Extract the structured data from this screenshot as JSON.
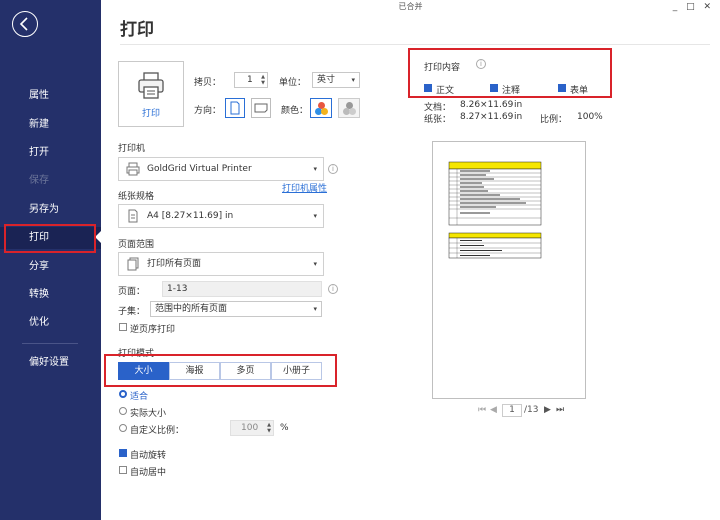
{
  "window": {
    "title": "已合并",
    "controls": "_ □ ✕"
  },
  "page_title": "打印",
  "sidebar": {
    "items": [
      {
        "label": "属性"
      },
      {
        "label": "新建"
      },
      {
        "label": "打开"
      },
      {
        "label": "保存"
      },
      {
        "label": "另存为"
      },
      {
        "label": "打印"
      },
      {
        "label": "分享"
      },
      {
        "label": "转换"
      },
      {
        "label": "优化"
      },
      {
        "label": "偏好设置"
      }
    ]
  },
  "print_button": {
    "label": "打印"
  },
  "copies": {
    "label": "拷贝：",
    "value": "1"
  },
  "unit": {
    "label": "单位：",
    "value": "英寸"
  },
  "orientation": {
    "label": "方向："
  },
  "color": {
    "label": "颜色："
  },
  "printer": {
    "label": "打印机",
    "value": "GoldGrid Virtual Printer",
    "properties_link": "打印机属性"
  },
  "paper": {
    "label": "纸张规格",
    "value": "A4 [8.27×11.69] in"
  },
  "page_range": {
    "label": "页面范围",
    "value": "打印所有页面",
    "pages_label": "页面：",
    "pages_value": "1-13",
    "subset_label": "子集：",
    "subset_value": "范围中的所有页面",
    "reverse_label": "逆页序打印"
  },
  "print_mode": {
    "label": "打印模式",
    "tabs": [
      "大小",
      "海报",
      "多页",
      "小册子"
    ],
    "active_tab": "大小",
    "options": {
      "fit": "适合",
      "actual": "实际大小",
      "custom": "自定义比例：",
      "custom_value": "100",
      "custom_unit": "%"
    },
    "auto_rotate": "自动旋转",
    "auto_center": "自动居中"
  },
  "print_content": {
    "label": "打印内容",
    "options": [
      "正文",
      "注释",
      "表单"
    ]
  },
  "doc_info": {
    "doc_label": "文档：",
    "doc_size": "8.26×11.69",
    "doc_unit": "in",
    "paper_label": "纸张：",
    "paper_size": "8.27×11.69",
    "paper_unit": "in",
    "scale_label": "比例：",
    "scale_value": "100%"
  },
  "pager": {
    "current": "1",
    "total": "/13"
  },
  "colors": {
    "sidebar": "#24306a",
    "accent": "#2a62c9",
    "highlight": "#d9232a"
  }
}
